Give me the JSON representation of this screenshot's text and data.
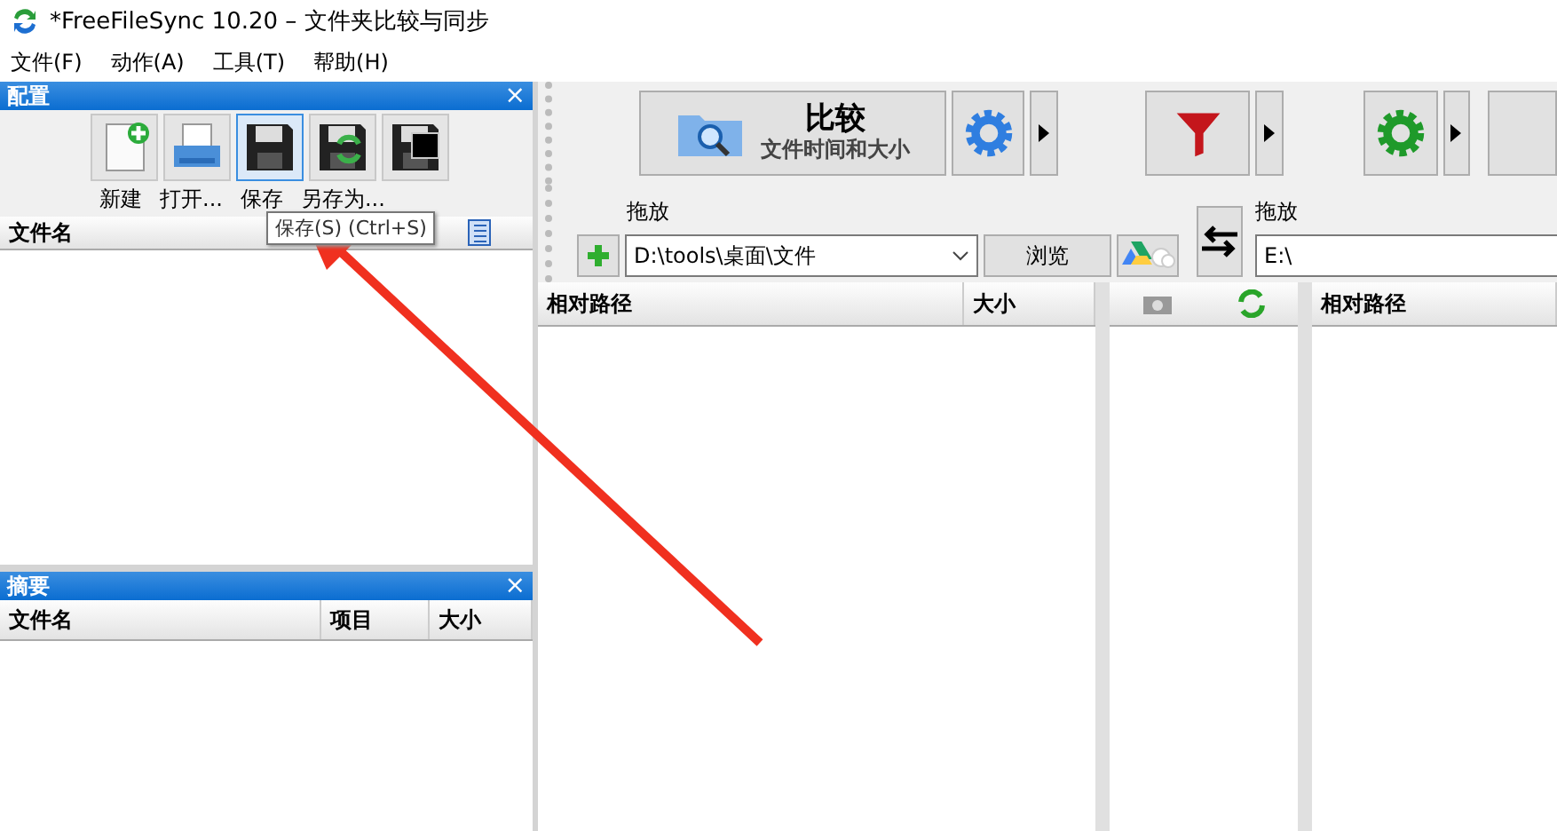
{
  "window": {
    "title": "*FreeFileSync 10.20 – 文件夹比较与同步"
  },
  "menu": [
    "文件(F)",
    "动作(A)",
    "工具(T)",
    "帮助(H)"
  ],
  "config_panel": {
    "title": "配置",
    "close": "×",
    "buttons": [
      {
        "kind": "new",
        "label": "新建",
        "selected": false
      },
      {
        "kind": "open",
        "label": "打开...",
        "selected": false
      },
      {
        "kind": "save",
        "label": "保存",
        "selected": true
      },
      {
        "kind": "saveas",
        "label": "另存为...",
        "selected": false
      },
      {
        "kind": "batch",
        "selected": false
      }
    ],
    "column": "文件名",
    "tooltip": "保存(S) (Ctrl+S)"
  },
  "summary_panel": {
    "title": "摘要",
    "close": "×",
    "columns": [
      "文件名",
      "项目",
      "大小"
    ]
  },
  "toolbar": {
    "compare": {
      "title": "比较",
      "subtitle": "文件时间和大小"
    }
  },
  "left_folder": {
    "label": "拖放",
    "path": "D:\\tools\\桌面\\文件",
    "browse": "浏览"
  },
  "right_folder": {
    "label": "拖放",
    "path": "E:\\"
  },
  "grid": {
    "left_columns": [
      "相对路径",
      "大小"
    ],
    "right_columns": [
      "相对路径"
    ]
  }
}
